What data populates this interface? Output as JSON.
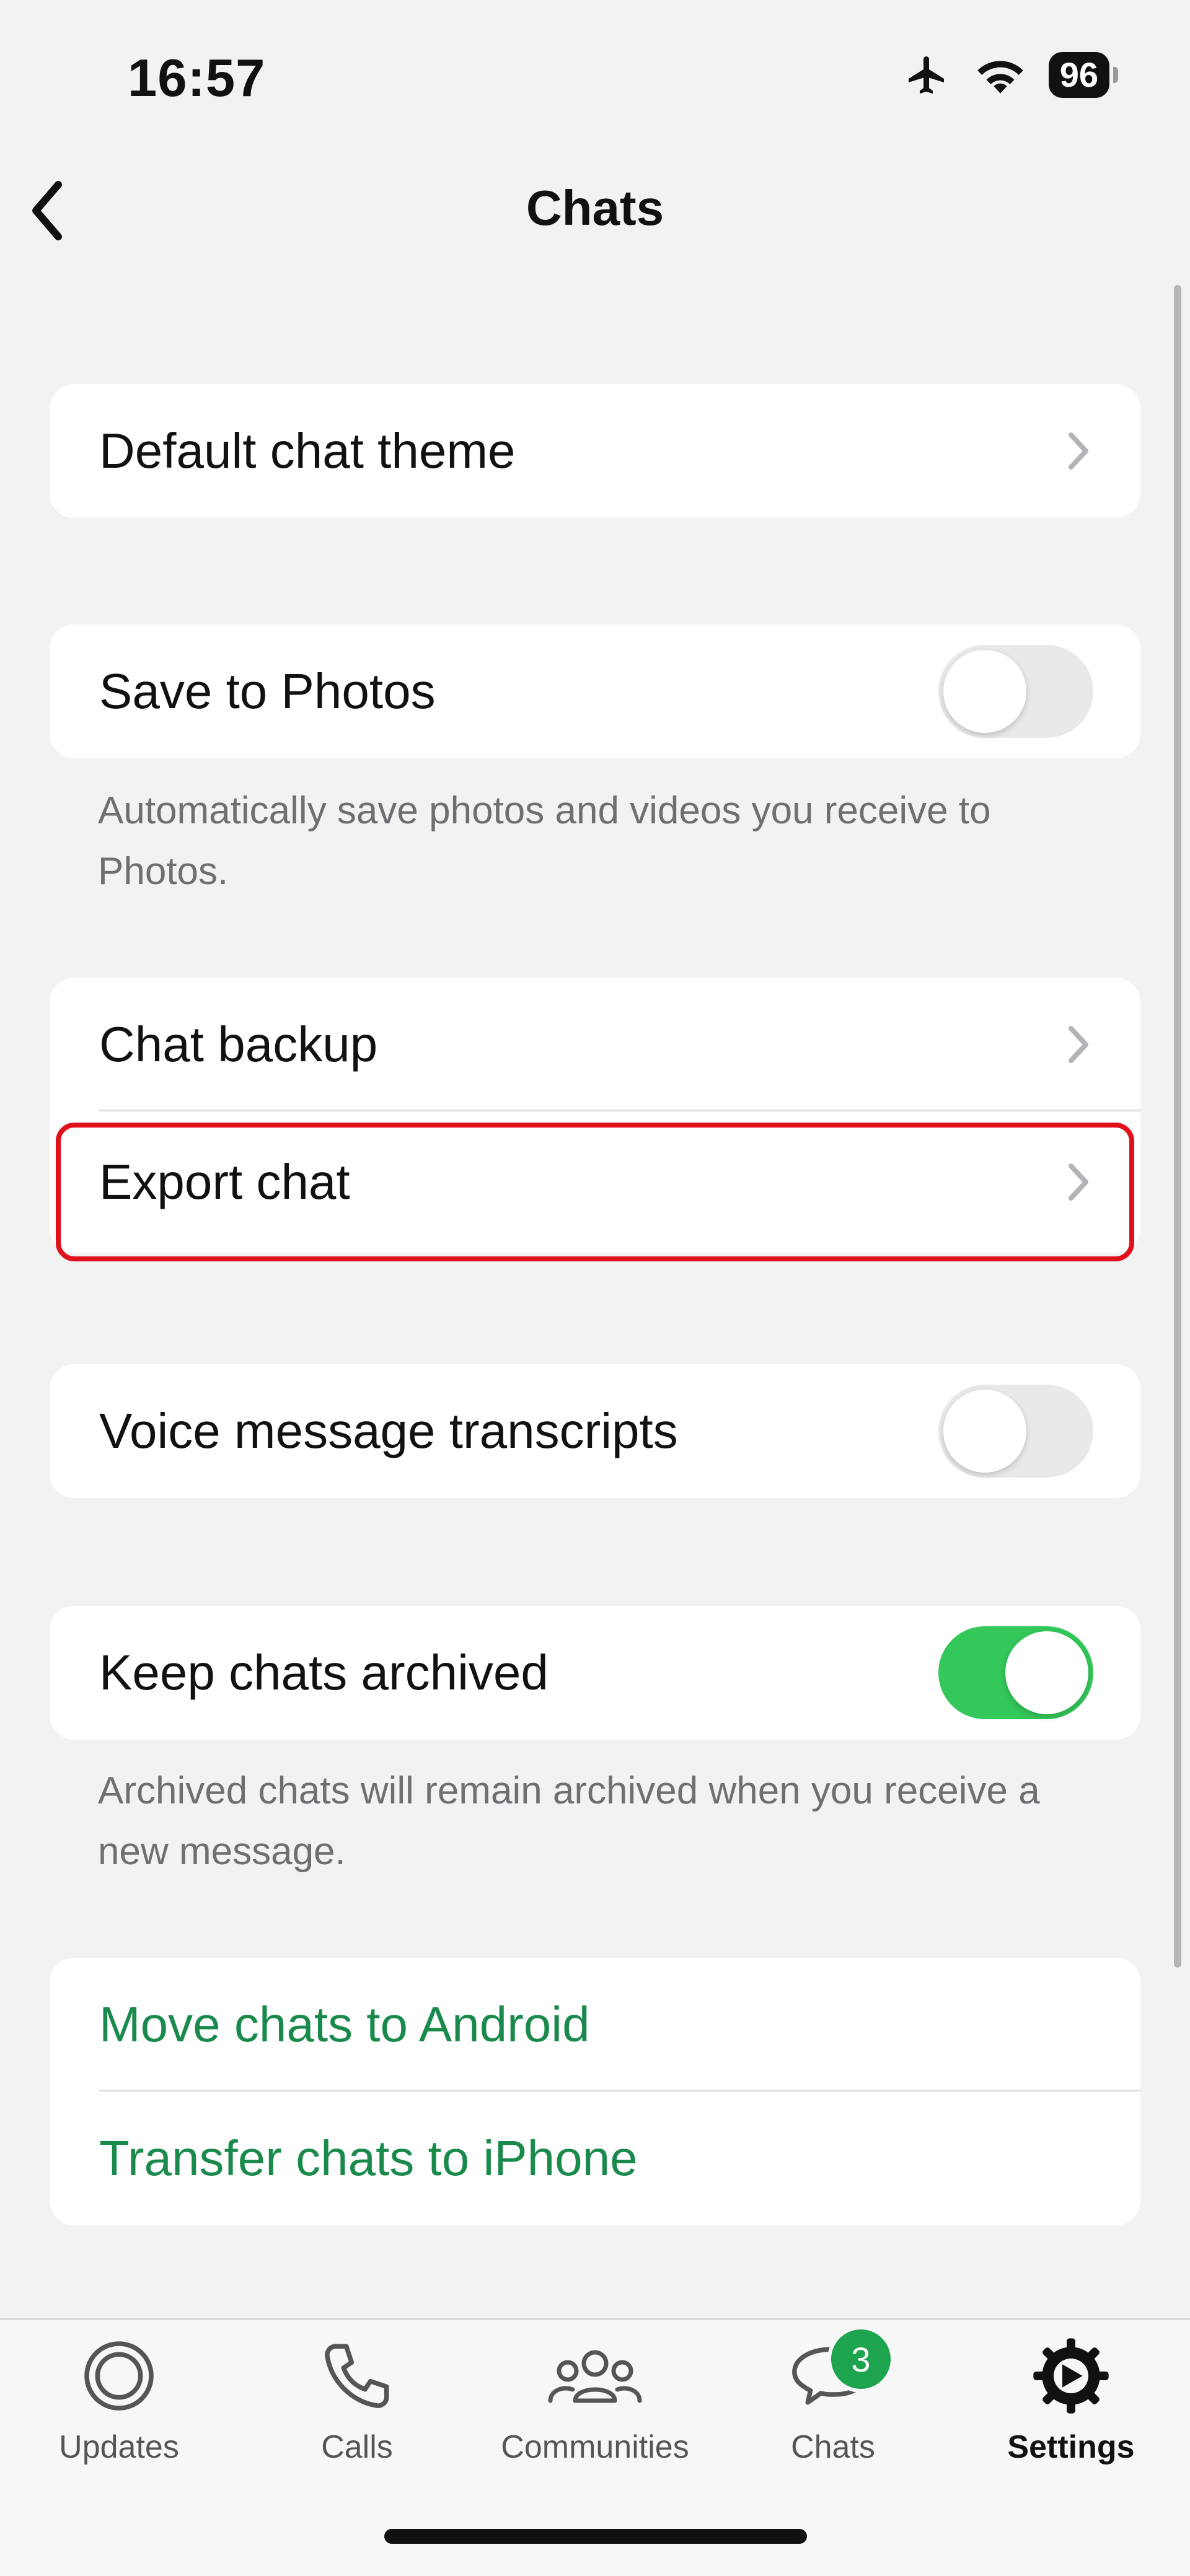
{
  "status_bar": {
    "time": "16:57",
    "battery": "96"
  },
  "header": {
    "title": "Chats"
  },
  "settings": {
    "default_theme": {
      "label": "Default chat theme"
    },
    "save_to_photos": {
      "label": "Save to Photos",
      "enabled": false,
      "footnote": "Automatically save photos and videos you receive to Photos."
    },
    "chat_backup": {
      "label": "Chat backup"
    },
    "export_chat": {
      "label": "Export chat"
    },
    "voice_transcripts": {
      "label": "Voice message transcripts",
      "enabled": false
    },
    "keep_archived": {
      "label": "Keep chats archived",
      "enabled": true,
      "footnote": "Archived chats will remain archived when you receive a new message."
    },
    "move_android": {
      "label": "Move chats to Android"
    },
    "transfer_iphone": {
      "label": "Transfer chats to iPhone"
    }
  },
  "tabbar": {
    "updates": "Updates",
    "calls": "Calls",
    "communities": "Communities",
    "chats": "Chats",
    "chats_badge": "3",
    "settings": "Settings",
    "active": "Settings"
  },
  "colors": {
    "accent_green": "#1a8a4c",
    "toggle_on": "#34c759",
    "highlight": "#e0111b"
  }
}
